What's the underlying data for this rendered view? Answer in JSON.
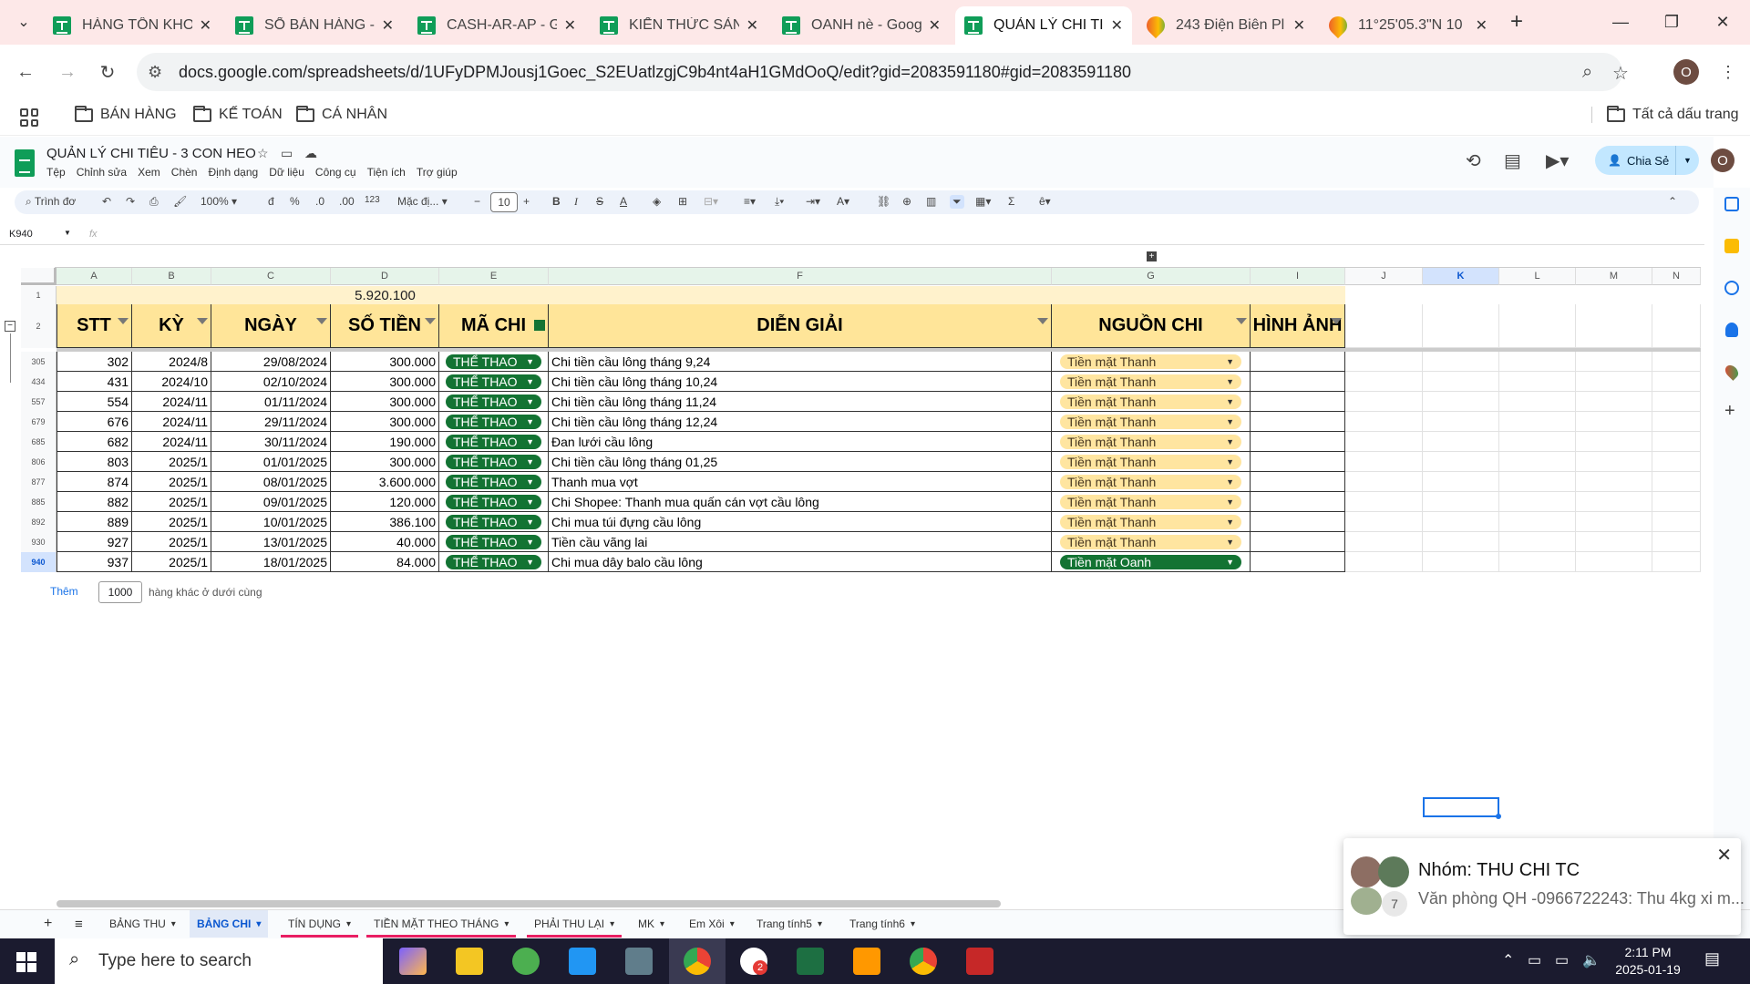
{
  "browser": {
    "tabs": [
      {
        "title": "HÀNG TỒN KHO",
        "icon": "sheets-icon"
      },
      {
        "title": "SỔ BÁN HÀNG -",
        "icon": "sheets-icon"
      },
      {
        "title": "CASH-AR-AP - G",
        "icon": "sheets-icon"
      },
      {
        "title": "KIẾN THỨC SẢN",
        "icon": "sheets-icon"
      },
      {
        "title": "OANH nè - Goog",
        "icon": "sheets-icon"
      },
      {
        "title": "QUẢN LÝ CHI TI",
        "icon": "sheets-icon",
        "active": true
      },
      {
        "title": "243 Điện Biên Pl",
        "icon": "maps-icon"
      },
      {
        "title": "11°25'05.3\"N 10",
        "icon": "maps-icon"
      }
    ],
    "url": "docs.google.com/spreadsheets/d/1UFyDPMJousj1Goec_S2EUatlzgjC9b4nt4aH1GMdOoQ/edit?gid=2083591180#gid=2083591180",
    "profile_initial": "O",
    "bookmarks": [
      "BÁN HÀNG",
      "KẾ TOÁN",
      "CÁ NHÂN"
    ],
    "all_bookmarks": "Tất cả dấu trang"
  },
  "doc": {
    "title": "QUẢN LÝ CHI TIÊU - 3 CON HEO",
    "menu": [
      "Tệp",
      "Chỉnh sửa",
      "Xem",
      "Chèn",
      "Định dạng",
      "Dữ liệu",
      "Công cụ",
      "Tiện ích",
      "Trợ giúp"
    ],
    "share_label": "Chia Sẻ"
  },
  "toolbar": {
    "search_menus": "Trình đơ",
    "zoom": "100%",
    "currency": "đ",
    "percent": "%",
    "dec_minus": ".0",
    "dec_plus": ".00",
    "number_fmt": "123",
    "font": "Mặc đị...",
    "font_size": "10"
  },
  "formula_bar": {
    "cell_ref": "K940",
    "fx": "fx"
  },
  "sheet": {
    "columns": [
      "A",
      "B",
      "C",
      "D",
      "E",
      "F",
      "G",
      "I",
      "J",
      "K",
      "L",
      "M",
      "N"
    ],
    "total_row": {
      "row": "1",
      "value": "5.920.100"
    },
    "header_row": "2",
    "headers": [
      "STT",
      "KỲ",
      "NGÀY",
      "SỐ TIỀN",
      "MÃ CHI",
      "DIỄN GIẢI",
      "NGUỒN CHI",
      "HÌNH ẢNH"
    ],
    "rows": [
      {
        "row": "305",
        "stt": "302",
        "ky": "2024/8",
        "ngay": "29/08/2024",
        "tien": "300.000",
        "ma": "THỂ THAO",
        "dien_giai": "Chi tiền cầu lông tháng 9,24",
        "nguon": "Tiền mặt Thanh"
      },
      {
        "row": "434",
        "stt": "431",
        "ky": "2024/10",
        "ngay": "02/10/2024",
        "tien": "300.000",
        "ma": "THỂ THAO",
        "dien_giai": "Chi tiền cầu lông tháng 10,24",
        "nguon": "Tiền mặt Thanh"
      },
      {
        "row": "557",
        "stt": "554",
        "ky": "2024/11",
        "ngay": "01/11/2024",
        "tien": "300.000",
        "ma": "THỂ THAO",
        "dien_giai": "Chi tiền cầu lông tháng 11,24",
        "nguon": "Tiền mặt Thanh"
      },
      {
        "row": "679",
        "stt": "676",
        "ky": "2024/11",
        "ngay": "29/11/2024",
        "tien": "300.000",
        "ma": "THỂ THAO",
        "dien_giai": "Chi tiền cầu lông tháng 12,24",
        "nguon": "Tiền mặt Thanh"
      },
      {
        "row": "685",
        "stt": "682",
        "ky": "2024/11",
        "ngay": "30/11/2024",
        "tien": "190.000",
        "ma": "THỂ THAO",
        "dien_giai": "Đan lưới cầu lông",
        "nguon": "Tiền mặt Thanh"
      },
      {
        "row": "806",
        "stt": "803",
        "ky": "2025/1",
        "ngay": "01/01/2025",
        "tien": "300.000",
        "ma": "THỂ THAO",
        "dien_giai": "Chi tiền cầu lông tháng 01,25",
        "nguon": "Tiền mặt Thanh"
      },
      {
        "row": "877",
        "stt": "874",
        "ky": "2025/1",
        "ngay": "08/01/2025",
        "tien": "3.600.000",
        "ma": "THỂ THAO",
        "dien_giai": "Thanh mua vợt",
        "nguon": "Tiền mặt Thanh"
      },
      {
        "row": "885",
        "stt": "882",
        "ky": "2025/1",
        "ngay": "09/01/2025",
        "tien": "120.000",
        "ma": "THỂ THAO",
        "dien_giai": "Chi Shopee: Thanh mua quấn cán vợt cầu lông",
        "nguon": "Tiền mặt Thanh"
      },
      {
        "row": "892",
        "stt": "889",
        "ky": "2025/1",
        "ngay": "10/01/2025",
        "tien": "386.100",
        "ma": "THỂ THAO",
        "dien_giai": "Chi mua túi đựng cầu lông",
        "nguon": "Tiền mặt Thanh"
      },
      {
        "row": "930",
        "stt": "927",
        "ky": "2025/1",
        "ngay": "13/01/2025",
        "tien": "40.000",
        "ma": "THỂ THAO",
        "dien_giai": "Tiền cầu vãng lai",
        "nguon": "Tiền mặt Thanh"
      },
      {
        "row": "940",
        "stt": "937",
        "ky": "2025/1",
        "ngay": "18/01/2025",
        "tien": "84.000",
        "ma": "THỂ THAO",
        "dien_giai": "Chi mua dây balo cầu lông",
        "nguon": "Tiền mặt Oanh"
      }
    ],
    "add_label": "Thêm",
    "add_count": "1000",
    "add_suffix": "hàng khác ở dưới cùng"
  },
  "sheet_tabs": [
    "BẢNG THU",
    "BẢNG CHI",
    "TÍN DỤNG",
    "TIỀN MẶT THEO THÁNG",
    "PHẢI THU LẠI",
    "MK",
    "Em Xôi",
    "Trang tính5",
    "Trang tính6"
  ],
  "active_sheet_tab": "BẢNG CHI",
  "notification": {
    "title": "Nhóm: THU CHI TC",
    "message": "Văn phòng QH -0966722243: Thu 4kg xi m...",
    "count": "7"
  },
  "taskbar": {
    "search_placeholder": "Type here to search",
    "time": "2:11 PM",
    "date": "2025-01-19",
    "zalo_badge": "2"
  },
  "colors": {
    "chip_green": "#137333",
    "chip_yellow": "#ffe5a0",
    "header_fill": "#ffe599"
  }
}
